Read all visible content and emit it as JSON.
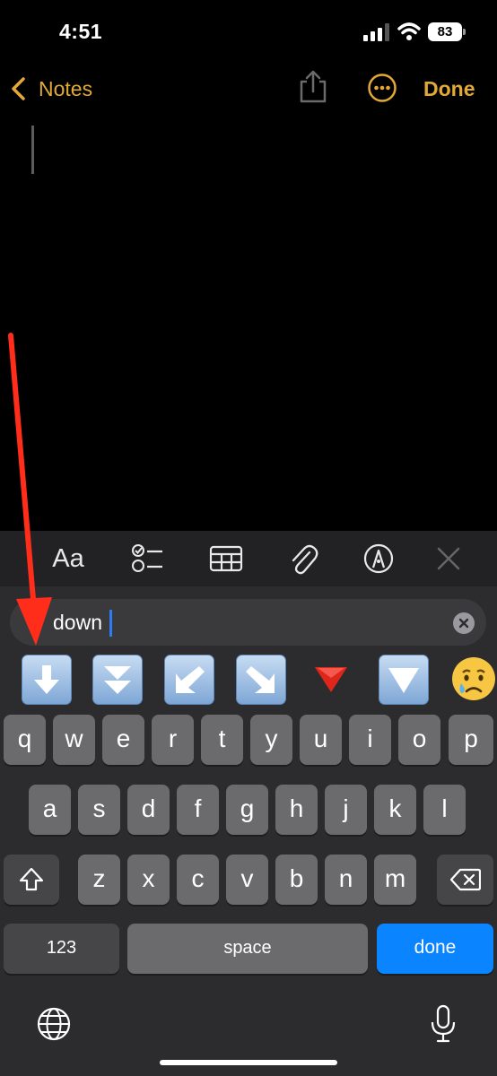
{
  "status_bar": {
    "time": "4:51",
    "battery": "83"
  },
  "nav": {
    "back_label": "Notes",
    "done_label": "Done"
  },
  "toolbar": {
    "format_label": "Aa"
  },
  "emoji_search": {
    "query": "down"
  },
  "emoji_results": [
    {
      "name": "down-arrow-emoji"
    },
    {
      "name": "fast-down-button-emoji"
    },
    {
      "name": "down-left-arrow-emoji"
    },
    {
      "name": "down-right-arrow-emoji"
    },
    {
      "name": "red-triangle-down-emoji"
    },
    {
      "name": "downwards-button-emoji"
    },
    {
      "name": "crying-face-emoji"
    }
  ],
  "keyboard": {
    "row1": [
      "q",
      "w",
      "e",
      "r",
      "t",
      "y",
      "u",
      "i",
      "o",
      "p"
    ],
    "row2": [
      "a",
      "s",
      "d",
      "f",
      "g",
      "h",
      "j",
      "k",
      "l"
    ],
    "row3": [
      "z",
      "x",
      "c",
      "v",
      "b",
      "n",
      "m"
    ],
    "numbers_label": "123",
    "space_label": "space",
    "done_label": "done"
  },
  "colors": {
    "accent": "#e2a935",
    "done_key": "#0a84ff",
    "annotation_arrow": "#ff2d1a"
  }
}
